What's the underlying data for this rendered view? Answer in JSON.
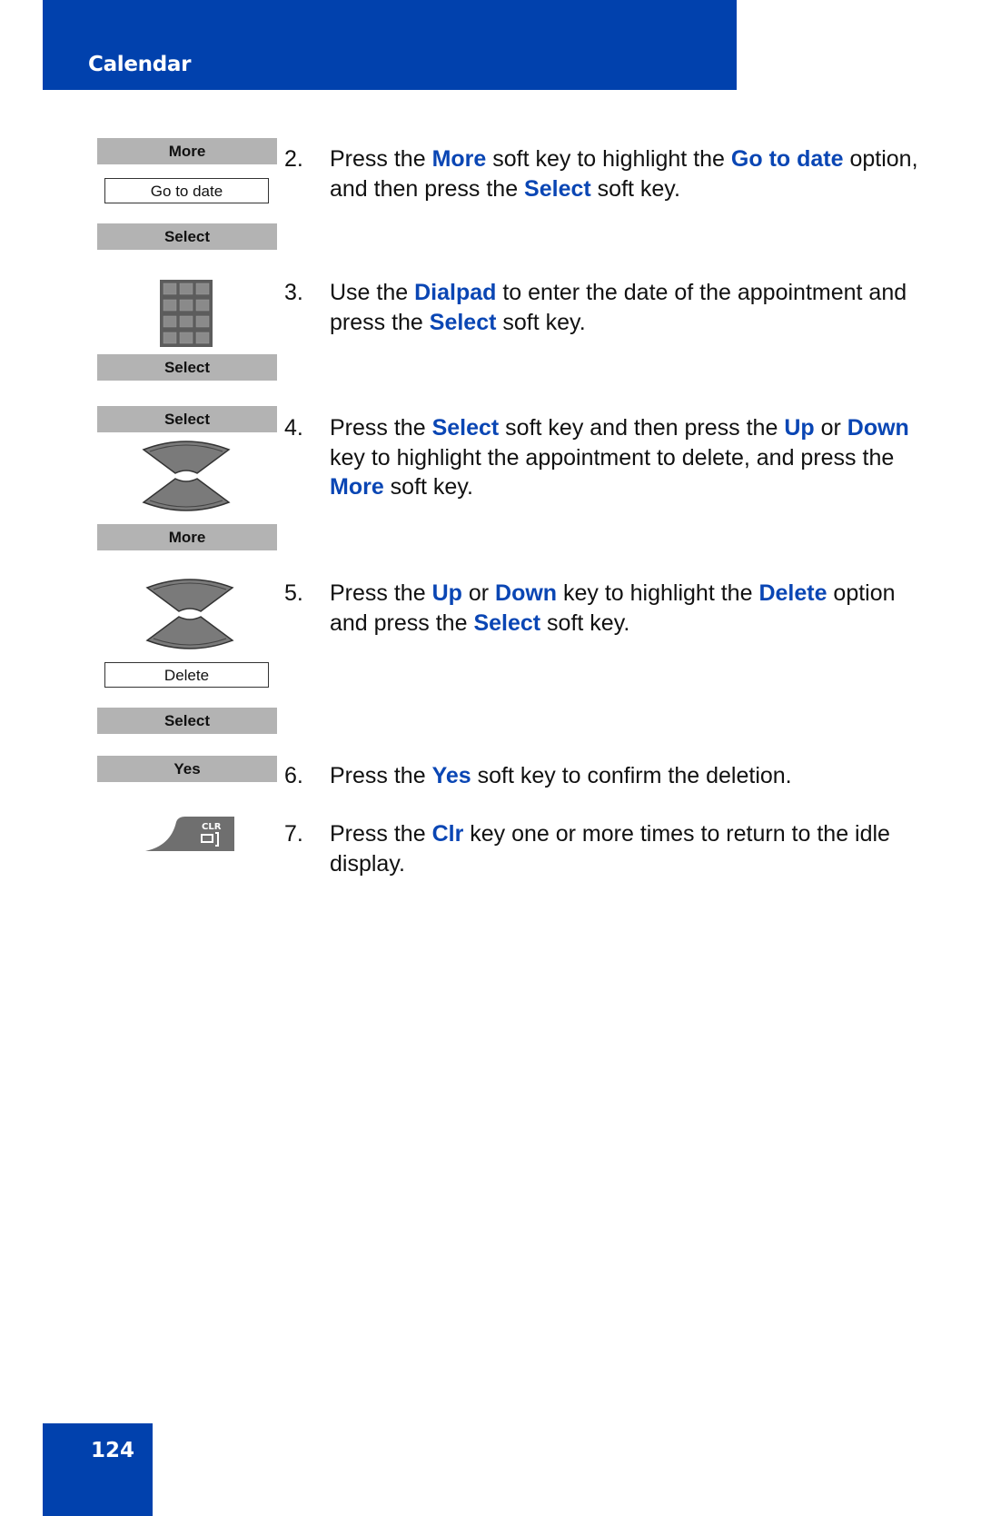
{
  "header": {
    "title": "Calendar"
  },
  "footer": {
    "page_number": "124"
  },
  "colors": {
    "brand_blue": "#0141ad",
    "keyword_blue": "#0a46b4",
    "softkey_gray": "#b3b3b3"
  },
  "left_column": {
    "softkey_more_1": "More",
    "display_go_to_date": "Go to date",
    "softkey_select_1": "Select",
    "dialpad_icon": "dialpad-icon",
    "softkey_select_2": "Select",
    "softkey_select_3": "Select",
    "nav_icon_1": "up-down-nav-key-icon",
    "softkey_more_2": "More",
    "nav_icon_2": "up-down-nav-key-icon",
    "display_delete": "Delete",
    "softkey_select_4": "Select",
    "softkey_yes": "Yes",
    "clr_key_label": "CLR"
  },
  "steps": [
    {
      "num": "2.",
      "parts": [
        {
          "t": "Press the "
        },
        {
          "t": "More",
          "kw": true
        },
        {
          "t": " soft key to highlight the "
        },
        {
          "t": "Go to date",
          "kw": true
        },
        {
          "t": " option, and then press the "
        },
        {
          "t": "Select",
          "kw": true
        },
        {
          "t": " soft key."
        }
      ]
    },
    {
      "num": "3.",
      "parts": [
        {
          "t": "Use the "
        },
        {
          "t": "Dialpad",
          "kw": true
        },
        {
          "t": " to enter the date of the appointment and press the "
        },
        {
          "t": "Select",
          "kw": true
        },
        {
          "t": " soft key."
        }
      ]
    },
    {
      "num": "4.",
      "parts": [
        {
          "t": "Press the "
        },
        {
          "t": "Select",
          "kw": true
        },
        {
          "t": " soft key and then press the "
        },
        {
          "t": "Up",
          "kw": true
        },
        {
          "t": " or "
        },
        {
          "t": "Down",
          "kw": true
        },
        {
          "t": " key to highlight the appointment to delete, and press the "
        },
        {
          "t": "More",
          "kw": true
        },
        {
          "t": " soft key."
        }
      ]
    },
    {
      "num": "5.",
      "parts": [
        {
          "t": "Press the "
        },
        {
          "t": "Up",
          "kw": true
        },
        {
          "t": " or "
        },
        {
          "t": "Down",
          "kw": true
        },
        {
          "t": " key to highlight the "
        },
        {
          "t": "Delete",
          "kw": true
        },
        {
          "t": " option and press the "
        },
        {
          "t": "Select",
          "kw": true
        },
        {
          "t": " soft key."
        }
      ]
    },
    {
      "num": "6.",
      "parts": [
        {
          "t": "Press the "
        },
        {
          "t": "Yes",
          "kw": true
        },
        {
          "t": " soft key to confirm the deletion."
        }
      ]
    },
    {
      "num": "7.",
      "parts": [
        {
          "t": "Press the "
        },
        {
          "t": "Clr",
          "kw": true
        },
        {
          "t": " key one or more times to return to the idle display."
        }
      ]
    }
  ]
}
